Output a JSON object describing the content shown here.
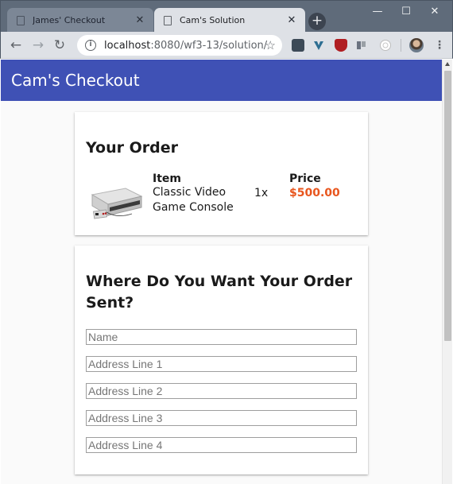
{
  "browser": {
    "tabs": [
      {
        "title": "James' Checkout",
        "active": false
      },
      {
        "title": "Cam's Solution",
        "active": true
      }
    ],
    "new_tab_label": "+",
    "window_controls": {
      "minimize": "—",
      "maximize": "☐",
      "close": "✕"
    },
    "nav": {
      "back": "←",
      "forward": "→",
      "reload": "↻"
    },
    "url_host": "localhost",
    "url_rest": ":8080/wf3-13/solution/",
    "star": "☆",
    "menu": "⋮"
  },
  "app": {
    "title": "Cam's Checkout",
    "accent_color": "#3f51b5",
    "price_color": "#e8561e"
  },
  "order": {
    "heading": "Your Order",
    "item_col_label": "Item",
    "price_col_label": "Price",
    "item_name": "Classic Video Game Console",
    "quantity": "1x",
    "price": "$500.00",
    "item_image": "video-game-console"
  },
  "shipping": {
    "heading": "Where Do You Want Your Order Sent?",
    "fields": [
      {
        "placeholder": "Name",
        "value": ""
      },
      {
        "placeholder": "Address Line 1",
        "value": ""
      },
      {
        "placeholder": "Address Line 2",
        "value": ""
      },
      {
        "placeholder": "Address Line 3",
        "value": ""
      },
      {
        "placeholder": "Address Line 4",
        "value": ""
      }
    ]
  }
}
